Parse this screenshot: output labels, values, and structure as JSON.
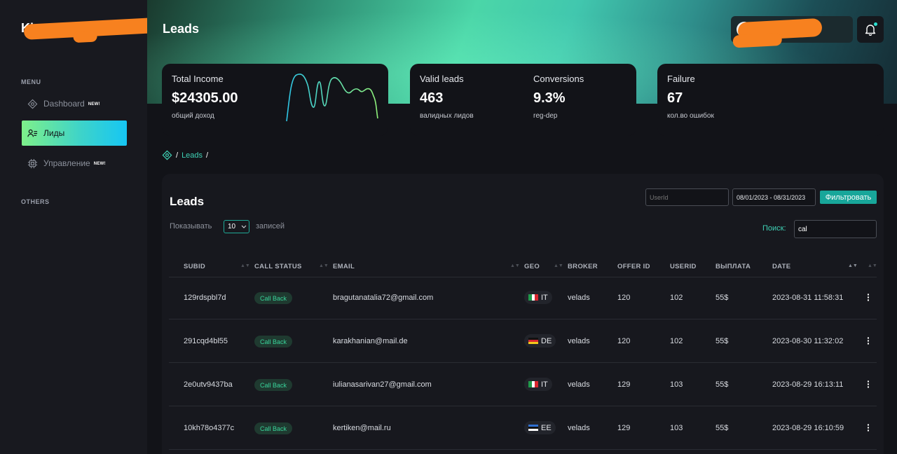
{
  "header": {
    "title": "Leads"
  },
  "sidebar": {
    "logo_text": "Ki",
    "menu_label": "MENU",
    "others_label": "OTHERS",
    "items": [
      {
        "label": "Dashboard",
        "badge": "NEW!",
        "icon": "dashboard-icon"
      },
      {
        "label": "Лиды",
        "badge": "",
        "icon": "leads-icon",
        "active": true
      },
      {
        "label": "Управление",
        "badge": "NEW!",
        "icon": "chip-icon"
      }
    ]
  },
  "stats": {
    "income": {
      "label": "Total Income",
      "value": "$24305.00",
      "sub": "общий доход"
    },
    "valid": {
      "label": "Valid leads",
      "value": "463",
      "sub": "валидных лидов"
    },
    "conv": {
      "label": "Conversions",
      "value": "9.3%",
      "sub": "reg-dep"
    },
    "failure": {
      "label": "Failure",
      "value": "67",
      "sub": "кол.во ошибок"
    }
  },
  "breadcrumb": {
    "sep": "/",
    "link": "Leads"
  },
  "leads": {
    "title": "Leads",
    "userid_placeholder": "UserId",
    "date_range": "08/01/2023 - 08/31/2023",
    "filter_button": "Фильтровать",
    "show_label": "Показывать",
    "page_size": "10",
    "records_label": "записей",
    "search_label": "Поиск:",
    "search_value": "cal",
    "columns": [
      "SUBID",
      "CALL STATUS",
      "EMAIL",
      "GEO",
      "BROKER",
      "OFFER ID",
      "USERID",
      "ВЫПЛАТА",
      "DATE"
    ],
    "rows": [
      {
        "subid": "129rdspbl7d",
        "status": "Call Back",
        "email": "bragutanatalia72@gmail.com",
        "geo": "IT",
        "broker": "velads",
        "offer": "120",
        "userid": "102",
        "payout": "55$",
        "date": "2023-08-31 11:58:31"
      },
      {
        "subid": "291cqd4bl55",
        "status": "Call Back",
        "email": "karakhanian@mail.de",
        "geo": "DE",
        "broker": "velads",
        "offer": "120",
        "userid": "102",
        "payout": "55$",
        "date": "2023-08-30 11:32:02"
      },
      {
        "subid": "2e0utv9437ba",
        "status": "Call Back",
        "email": "iulianasarivan27@gmail.com",
        "geo": "IT",
        "broker": "velads",
        "offer": "129",
        "userid": "103",
        "payout": "55$",
        "date": "2023-08-29 16:13:11"
      },
      {
        "subid": "10kh78o4377c",
        "status": "Call Back",
        "email": "kertiken@mail.ru",
        "geo": "EE",
        "broker": "velads",
        "offer": "129",
        "userid": "103",
        "payout": "55$",
        "date": "2023-08-29 16:10:59"
      }
    ]
  },
  "colors": {
    "accent": "#3fd1b5",
    "filter_button": "#18a69a",
    "callback_text": "#39d49b",
    "redaction": "#f7811f"
  }
}
